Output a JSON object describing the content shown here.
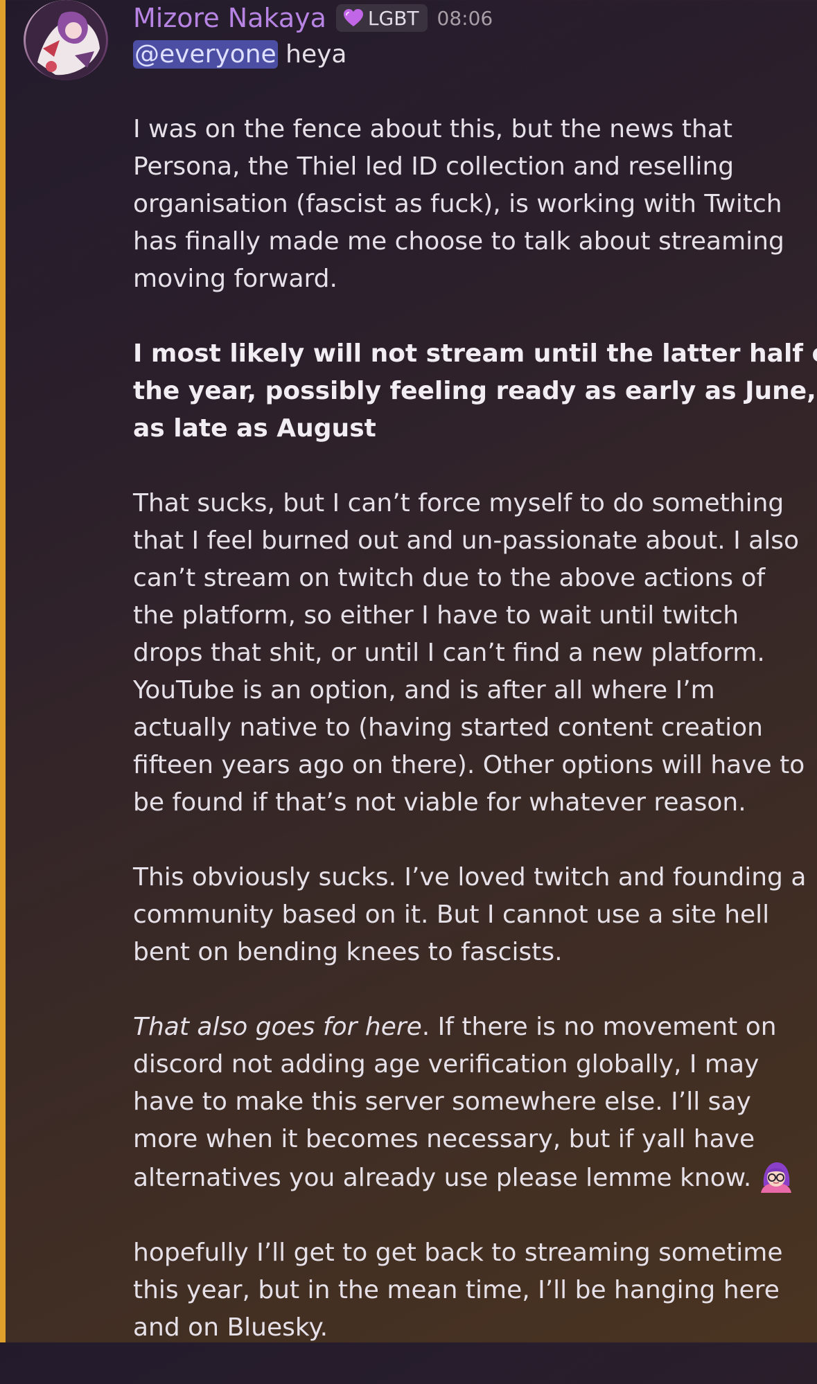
{
  "colors": {
    "mention_stripe": "#e0a12c",
    "username": "#b784e3",
    "mention_bg": "#4b4ea3",
    "badge_bg": "#3a333f"
  },
  "message": {
    "author": "Mizore Nakaya",
    "badge_icon": "heart-icon",
    "badge_label": "LGBT",
    "timestamp": "08:06",
    "mention": "@everyone",
    "intro": " heya",
    "p1": [
      "I was on the fence about this, but the news that",
      "Persona, the Thiel led ID collection and reselling",
      "organisation (fascist as fuck), is working with Twitch",
      "has finally made me choose to talk about streaming",
      "moving forward."
    ],
    "p2": [
      "I most likely will not stream until the latter half of",
      "the year, possibly feeling ready as early as June, or",
      "as late as August"
    ],
    "p3": [
      "That sucks, but I can’t force myself to do something",
      "that I feel burned out and un-passionate about. I also",
      "can’t stream on twitch due to the above actions of",
      "the platform, so either I have to wait until twitch",
      "drops that shit, or until I can’t find a new platform.",
      "YouTube is an option, and is after all where I’m",
      "actually native to (having started content creation",
      "fifteen years ago on there). Other options will have to",
      "be found if that’s not viable for whatever reason."
    ],
    "p4": [
      "This obviously sucks. I’ve loved twitch and founding a",
      "community based on it. But I cannot use a site hell",
      "bent on bending knees to fascists."
    ],
    "p5_italic": "That also goes for here",
    "p5_first_rest": ". If there is no movement on",
    "p5": [
      "discord not adding age verification globally, I may",
      "have to make this server somewhere else. I’ll say",
      "more when it becomes necessary, but if yall have",
      "alternatives you already use please lemme know."
    ],
    "p5_emoji": "custom-emoji-girl-with-glasses",
    "p6": [
      "hopefully I’ll get to get back to streaming sometime",
      "this year, but in the mean time, I’ll be hanging here",
      "and on Bluesky."
    ]
  }
}
